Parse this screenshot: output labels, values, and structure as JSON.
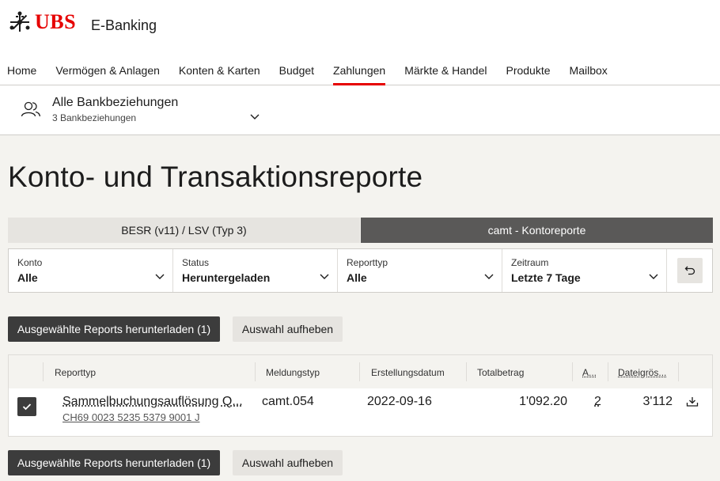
{
  "header": {
    "brand": "UBS",
    "app_title": "E-Banking",
    "accent": "#e60000"
  },
  "nav": [
    {
      "label": "Home"
    },
    {
      "label": "Vermögen & Anlagen"
    },
    {
      "label": "Konten & Karten"
    },
    {
      "label": "Budget"
    },
    {
      "label": "Zahlungen",
      "active": true
    },
    {
      "label": "Märkte & Handel"
    },
    {
      "label": "Produkte"
    },
    {
      "label": "Mailbox"
    }
  ],
  "bank": {
    "title": "Alle Bankbeziehungen",
    "subtitle": "3 Bankbeziehungen",
    "icon": "users-icon"
  },
  "page": {
    "title": "Konto- und Transaktionsreporte"
  },
  "tabs": [
    {
      "label": "BESR (v11) / LSV (Typ 3)",
      "active": false
    },
    {
      "label": "camt - Kontoreporte",
      "active": true
    }
  ],
  "filters": [
    {
      "label": "Konto",
      "value": "Alle"
    },
    {
      "label": "Status",
      "value": "Heruntergeladen"
    },
    {
      "label": "Reporttyp",
      "value": "Alle"
    },
    {
      "label": "Zeitraum",
      "value": "Letzte 7 Tage"
    }
  ],
  "actions": {
    "download_label": "Ausgewählte Reports herunterladen (1)",
    "clear_label": "Auswahl aufheben"
  },
  "table": {
    "columns": [
      "Reporttyp",
      "Meldungstyp",
      "Erstellungsdatum",
      "Totalbetrag",
      "A...",
      "Dateigrös..."
    ],
    "rows": [
      {
        "checked": true,
        "reporttyp": "Sammelbuchungsauflösung Q...",
        "account": "CH69 0023 5235 5379 9001 J",
        "meldungstyp": "camt.054",
        "date": "2022-09-16",
        "total": "1'092.20",
        "count": "2",
        "size": "3'112"
      }
    ]
  }
}
